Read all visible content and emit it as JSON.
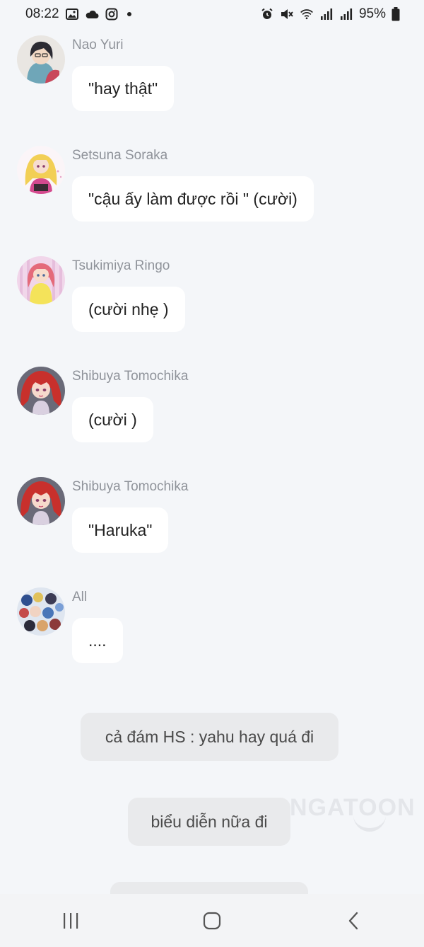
{
  "status_bar": {
    "time": "08:22",
    "battery": "95%",
    "icons": [
      "image-icon",
      "cloud-icon",
      "instagram-icon",
      "notification-dot",
      "alarm-icon",
      "mute-icon",
      "wifi-icon",
      "signal-icon",
      "signal-icon",
      "battery-icon"
    ]
  },
  "messages": [
    {
      "sender": "Nao Yuri",
      "text": "\"hay thật\"",
      "avatar": "nao-yuri-avatar"
    },
    {
      "sender": "Setsuna Soraka",
      "text": "\"cậu ấy làm được rồi \" (cười)",
      "avatar": "setsuna-soraka-avatar"
    },
    {
      "sender": "Tsukimiya Ringo",
      "text": "(cười nhẹ )",
      "avatar": "tsukimiya-ringo-avatar"
    },
    {
      "sender": "Shibuya Tomochika",
      "text": "(cười )",
      "avatar": "shibuya-tomochika-avatar"
    },
    {
      "sender": "Shibuya Tomochika",
      "text": "\"Haruka\"",
      "avatar": "shibuya-tomochika-avatar"
    },
    {
      "sender": "All",
      "text": "....",
      "avatar": "all-group-avatar"
    }
  ],
  "narration": [
    {
      "text": "cả đám HS : yahu hay quá đi"
    },
    {
      "text": "biểu diễn nữa đi"
    }
  ],
  "watermark": "NGATOON",
  "colors": {
    "background": "#f4f6f9",
    "bubble": "#ffffff",
    "narration_bubble": "#e9eaec",
    "sender_name": "#8f939a"
  },
  "nav_bar": {
    "buttons": [
      "recent-apps-icon",
      "home-icon",
      "back-icon"
    ]
  }
}
